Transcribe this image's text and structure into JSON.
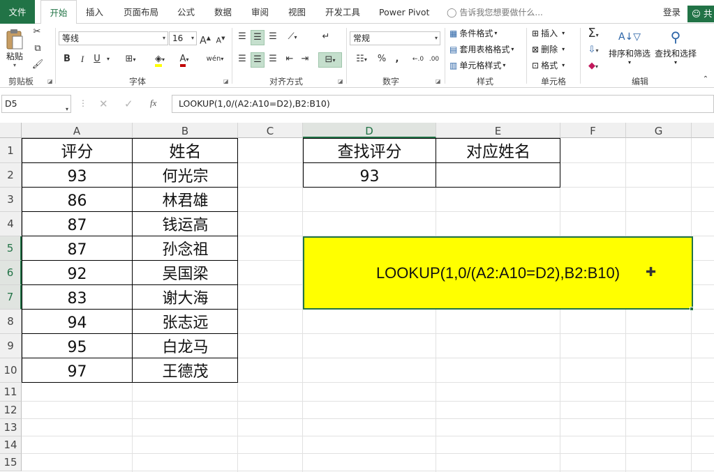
{
  "menu": {
    "tabs": [
      "文件",
      "开始",
      "插入",
      "页面布局",
      "公式",
      "数据",
      "审阅",
      "视图",
      "开发工具",
      "Power Pivot"
    ],
    "tell_me": "告诉我您想要做什么...",
    "login": "登录",
    "share": "共"
  },
  "ribbon": {
    "clipboard": {
      "paste": "粘贴",
      "label": "剪贴板"
    },
    "font": {
      "name": "等线",
      "size": "16",
      "bold": "B",
      "italic": "I",
      "underline": "U",
      "grow": "A",
      "shrink": "A",
      "wen": "wén",
      "label": "字体"
    },
    "alignment": {
      "label": "对齐方式"
    },
    "number": {
      "format": "常规",
      "percent": "%",
      "comma": ",",
      "label": "数字"
    },
    "styles": {
      "conditional": "条件格式",
      "table": "套用表格格式",
      "cell": "单元格样式",
      "label": "样式"
    },
    "cells": {
      "insert": "插入",
      "delete": "删除",
      "format": "格式",
      "label": "单元格"
    },
    "editing": {
      "sort": "排序和筛选",
      "find": "查找和选择",
      "label": "编辑"
    }
  },
  "formula_bar": {
    "name_box": "D5",
    "fx": "fx",
    "formula": "LOOKUP(1,0/(A2:A10=D2),B2:B10)"
  },
  "sheet": {
    "columns": [
      "A",
      "B",
      "C",
      "D",
      "E",
      "F",
      "G"
    ],
    "rows": [
      "1",
      "2",
      "3",
      "4",
      "5",
      "6",
      "7",
      "8",
      "9",
      "10",
      "11",
      "12",
      "13",
      "14",
      "15"
    ],
    "table": {
      "headers": [
        "评分",
        "姓名"
      ],
      "rows": [
        [
          "93",
          "何光宗"
        ],
        [
          "86",
          "林君雄"
        ],
        [
          "87",
          "钱运高"
        ],
        [
          "87",
          "孙念祖"
        ],
        [
          "92",
          "吴国梁"
        ],
        [
          "83",
          "谢大海"
        ],
        [
          "94",
          "张志远"
        ],
        [
          "95",
          "白龙马"
        ],
        [
          "97",
          "王德茂"
        ]
      ]
    },
    "lookup": {
      "headers": [
        "查找评分",
        "对应姓名"
      ],
      "value": "93",
      "result": ""
    },
    "note_box": {
      "text": "LOOKUP(1,0/(A2:A10=D2),B2:B10)",
      "color": "#FFFF00"
    }
  }
}
